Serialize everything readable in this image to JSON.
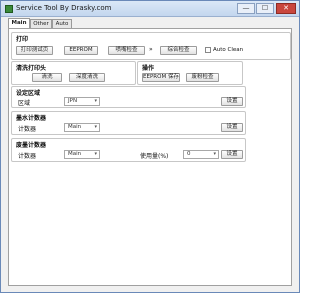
{
  "window": {
    "title": "Service Tool By Drasky.com",
    "minimize": "—",
    "maximize": "☐",
    "close": "✕"
  },
  "tabs": [
    "Main",
    "Other",
    "Auto"
  ],
  "print_group": {
    "title": "打印",
    "buttons": [
      "打印测试页",
      "EEPROM",
      "喷嘴检查",
      "综合检查"
    ],
    "arrow": "»",
    "auto_clean": "Auto Clean"
  },
  "clean_group": {
    "title": "清洗打印头",
    "buttons": [
      "清洗",
      "深度清洗"
    ]
  },
  "operate_group": {
    "title": "操作",
    "buttons": [
      "EEPROM 保存",
      "废粉检查"
    ]
  },
  "region_group": {
    "title": "设定区域",
    "label": "区域",
    "value": "JPN",
    "button": "设置"
  },
  "ink_group": {
    "title": "墨水计数器",
    "label": "计数器",
    "value": "Main",
    "button": "设置"
  },
  "waste_group": {
    "title": "废墨计数器",
    "label": "计数器",
    "value": "Main",
    "usage_label": "使用量(%)",
    "usage_value": "0",
    "button": "设置"
  }
}
